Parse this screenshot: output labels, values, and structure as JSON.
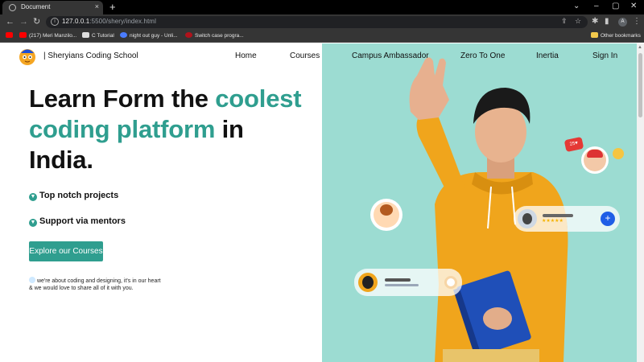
{
  "browser": {
    "tab_title": "Document",
    "tab_close": "×",
    "new_tab": "+",
    "url_host": "127.0.0.1",
    "url_rest": ":5500/shery/index.html",
    "window_controls": [
      "⌄",
      "–",
      "▢",
      "✕"
    ]
  },
  "bookmarks": [
    {
      "label": "",
      "icon": "youtube-icon"
    },
    {
      "label": "(217) Meri Manzilo...",
      "icon": "youtube-icon"
    },
    {
      "label": "C Tutorial",
      "icon": "github-icon"
    },
    {
      "label": "night out guy - Unli...",
      "icon": "globe-icon"
    },
    {
      "label": "Switch case progra...",
      "icon": "site-icon"
    }
  ],
  "other_bookmarks": "Other bookmarks",
  "header": {
    "brand": "| Sheryians Coding School",
    "nav": [
      "Home",
      "Courses",
      "Campus Ambassador",
      "Zero To One",
      "Inertia",
      "Sign In"
    ]
  },
  "hero": {
    "headline_1": "Learn Form the ",
    "headline_accent_1": "coolest",
    "headline_accent_2": "coding platform",
    "headline_2": " in",
    "headline_3": "India.",
    "features": [
      "Top notch projects",
      "Support via mentors"
    ],
    "cta": "Explore our Courses",
    "note": " we're about coding and designing, it's in our heart & we would love to share all of it with you.",
    "rating_stars": "★★★★★",
    "badge": "25"
  },
  "colors": {
    "accent": "#2f9e8f",
    "hero_bg": "#9cdcd2",
    "hoodie": "#f0a51c",
    "book": "#1f4fb8"
  }
}
